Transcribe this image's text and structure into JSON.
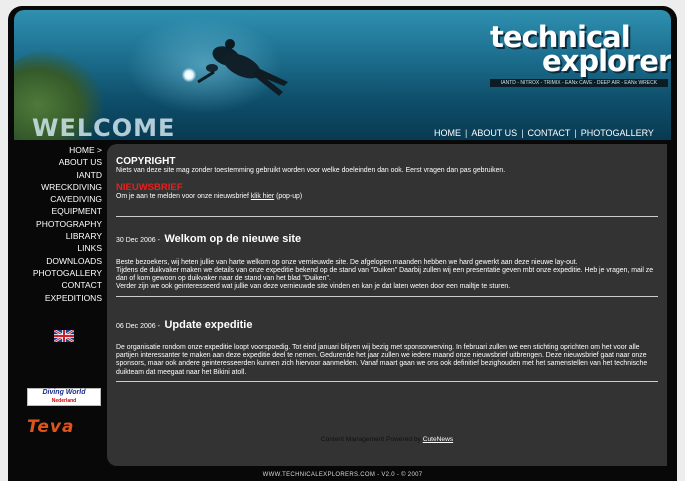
{
  "header": {
    "welcome": "WELCOME",
    "logo_line1": "technical",
    "logo_line2": "explorers",
    "logo_tagline": "IANTD - NITROX - TRIMIX - EANx CAVE - DEEP AIR - EANx WRECK",
    "top_nav": [
      "HOME",
      "ABOUT US",
      "CONTACT",
      "PHOTOGALLERY"
    ],
    "nav_separator": "|"
  },
  "sidebar": {
    "items": [
      "HOME >",
      "ABOUT US",
      "IANTD",
      "WRECKDIVING",
      "CAVEDIVING",
      "EQUIPMENT",
      "PHOTOGRAPHY",
      "LIBRARY",
      "LINKS",
      "DOWNLOADS",
      "PHOTOGALLERY",
      "CONTACT",
      "EXPEDITIONS"
    ],
    "flag_icon": "uk-flag-icon",
    "sponsor1_title": "Diving World",
    "sponsor1_sub": "Nederland",
    "sponsor2": "Teva"
  },
  "content": {
    "copyright_title": "COPYRIGHT",
    "copyright_text": "Niets van deze site mag zonder toestemming gebruikt worden voor welke doeleinden dan ook. Eerst vragen dan pas gebruiken.",
    "news_title": "NIEUWSBRIEF",
    "news_text_pre": "Om je aan te melden voor onze nieuwsbrief ",
    "news_link": "klik hier",
    "news_text_post": " (pop-up)",
    "posts": [
      {
        "date": "30 Dec 2006 -",
        "title": "Welkom op de nieuwe site",
        "body": [
          "Beste bezoekers, wij heten jullie van harte welkom op onze vernieuwde site. De afgelopen maanden hebben we hard gewerkt aan deze nieuwe lay-out.",
          "Tijdens de duikvaker maken we details van onze expeditie bekend op de stand van \"Duiken\" Daarbij zullen wij een presentatie geven mbt onze expeditie. Heb je vragen, mail ze dan of kom gewoon op duikvaker naar de stand van het blad \"Duiken\".",
          "Verder zijn we ook geinteresseerd wat jullie van deze vernieuwde site vinden en kan je dat laten weten door een mailtje te sturen."
        ]
      },
      {
        "date": "06 Dec 2006 -",
        "title": "Update expeditie",
        "body": [
          "De organisatie rondom onze expeditie loopt voorspoedig. Tot eind januari blijven wij bezig met sponsorwerving. In februari zullen we een stichting oprichten om het voor alle partijen interessanter te maken aan deze expeditie deel te nemen. Gedurende het jaar zullen we iedere maand onze nieuwsbrief uitbrengen. Deze nieuwsbrief gaat naar onze sponsors, maar ook andere geinteresseerden kunnen zich hiervoor aanmelden. Vanaf maart gaan we ons ook definitief bezighouden met het samenstellen van het technische duikteam dat meegaat naar het Bikini atoll."
        ]
      }
    ],
    "powered_text": "Content Management Powered by ",
    "powered_link": "CuteNews"
  },
  "footer": {
    "text": "WWW.TECHNICALEXPLORERS.COM - V2.0 - © 2007"
  }
}
